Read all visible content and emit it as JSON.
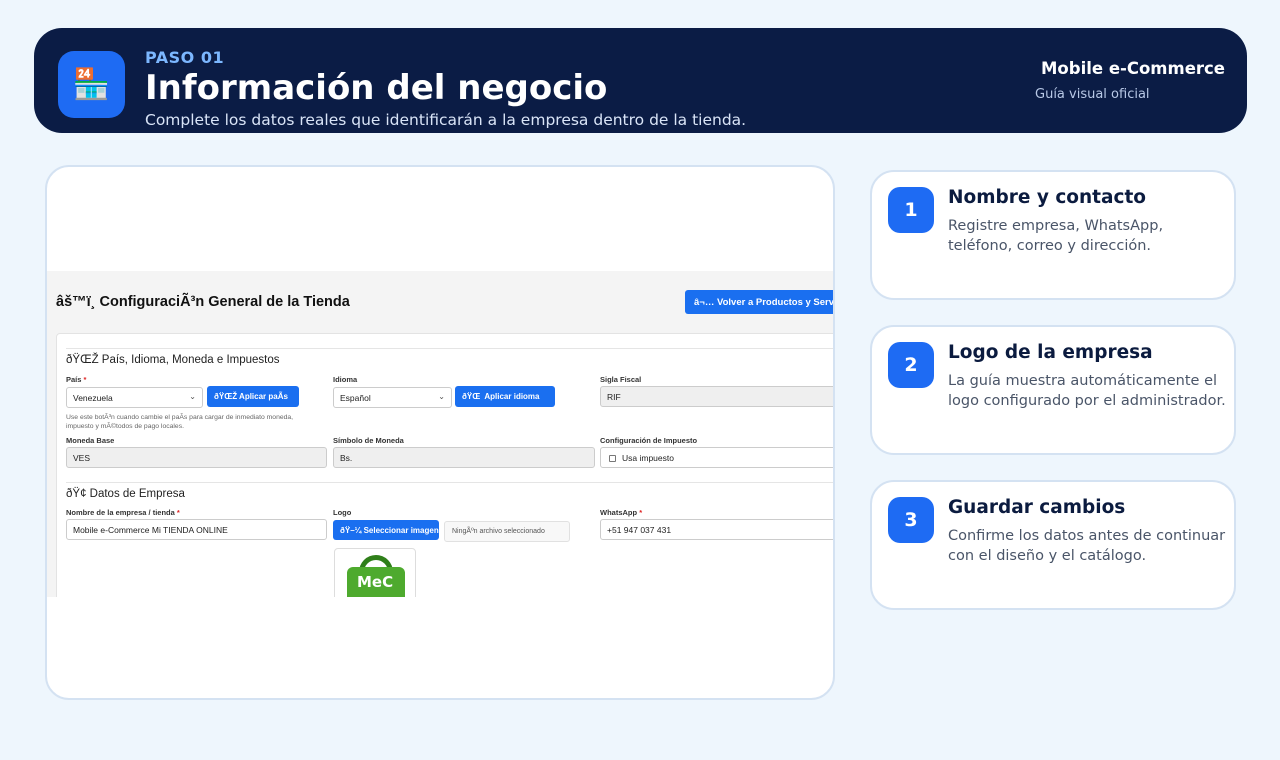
{
  "header": {
    "icon": "store-icon",
    "step": "PASO 01",
    "title": "Información del negocio",
    "subtitle": "Complete los datos reales que identificarán a la empresa dentro de la tienda.",
    "brand": "Mobile e-Commerce",
    "guide": "Guía visual oficial"
  },
  "screenshot": {
    "page_title": "âš™ï¸ ConfiguraciÃ³n General de la Tienda",
    "back_button": "â¬… Volver a Productos y Servicios",
    "section1": {
      "title": "ðŸŒŽ País, Idioma, Moneda e Impuestos",
      "pais_label": "País",
      "required_mark": "*",
      "pais_value": "Venezuela",
      "apply_country": "ðŸŒŽ Aplicar paÃs",
      "idioma_label": "Idioma",
      "idioma_value": "Español",
      "apply_language": "ðŸŒ  Aplicar idioma",
      "sigla_label": "Sigla Fiscal",
      "sigla_value": "RIF",
      "help": "Use este botÃ³n cuando cambie el paÃs para cargar de inmediato moneda, impuesto y mÃ©todos de pago locales.",
      "moneda_label": "Moneda Base",
      "moneda_value": "VES",
      "simbolo_label": "Símbolo de Moneda",
      "simbolo_value": "Bs.",
      "impuesto_label": "Configuración de Impuesto",
      "impuesto_value": "Usa impuesto"
    },
    "section2": {
      "title": "ðŸ¢ Datos de Empresa",
      "empresa_label": "Nombre de la empresa / tienda",
      "empresa_value": "Mobile e-Commerce Mi TIENDA ONLINE",
      "logo_label": "Logo",
      "select_image": "ðŸ–¼ Seleccionar imagen",
      "no_file": "NingÃºn archivo seleccionado",
      "whatsapp_label": "WhatsApp",
      "whatsapp_value": "+51 947 037 431",
      "logo_text": "MeC"
    }
  },
  "steps": [
    {
      "number": "1",
      "title": "Nombre y contacto",
      "text": "Registre empresa, WhatsApp, teléfono, correo y dirección."
    },
    {
      "number": "2",
      "title": "Logo de la empresa",
      "text": "La guía muestra automáticamente el logo configurado por el administrador."
    },
    {
      "number": "3",
      "title": "Guardar cambios",
      "text": "Confirme los datos antes de continuar con el diseño y el catálogo."
    }
  ]
}
